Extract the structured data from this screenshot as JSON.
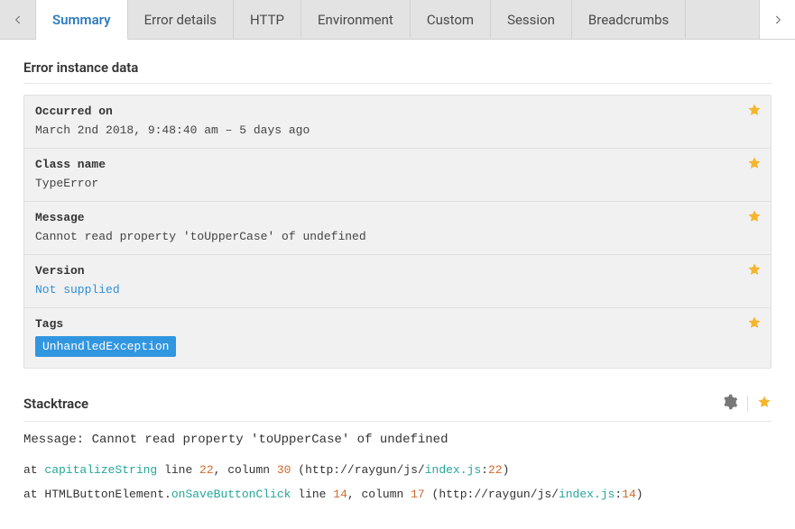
{
  "tabs": {
    "items": [
      {
        "label": "Summary",
        "active": true
      },
      {
        "label": "Error details",
        "active": false
      },
      {
        "label": "HTTP",
        "active": false
      },
      {
        "label": "Environment",
        "active": false
      },
      {
        "label": "Custom",
        "active": false
      },
      {
        "label": "Session",
        "active": false
      },
      {
        "label": "Breadcrumbs",
        "active": false
      }
    ]
  },
  "section_instance_title": "Error instance data",
  "rows": {
    "occurred": {
      "label": "Occurred on",
      "value": "March 2nd 2018, 9:48:40 am – 5 days ago"
    },
    "classname": {
      "label": "Class name",
      "value": "TypeError"
    },
    "message": {
      "label": "Message",
      "value": "Cannot read property 'toUpperCase' of undefined"
    },
    "version": {
      "label": "Version",
      "value": "Not supplied"
    },
    "tags": {
      "label": "Tags",
      "value": "UnhandledException"
    }
  },
  "stacktrace": {
    "title": "Stacktrace",
    "message_prefix": "Message: ",
    "message": "Cannot read property 'toUpperCase' of undefined",
    "frames": [
      {
        "at": "at ",
        "func": "capitalizeString",
        "rest1": " line ",
        "line": "22",
        "rest2": ", column ",
        "col": "30",
        "rest3": " (http://raygun/js/",
        "file": "index.js",
        "sep": ":",
        "fline": "22",
        "close": ")"
      },
      {
        "at": "at ",
        "prefix_plain": "HTMLButtonElement.",
        "func": "onSaveButtonClick",
        "rest1": " line ",
        "line": "14",
        "rest2": ", column ",
        "col": "17",
        "rest3": " (http://raygun/js/",
        "file": "index.js",
        "sep": ":",
        "fline": "14",
        "close": ")"
      }
    ]
  }
}
